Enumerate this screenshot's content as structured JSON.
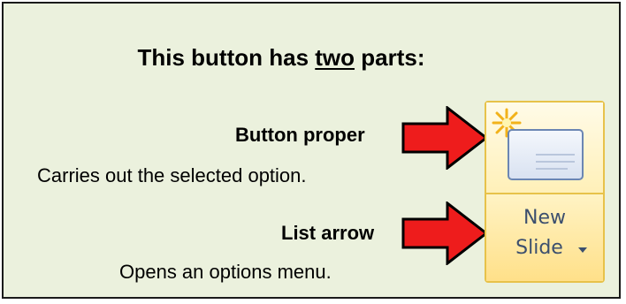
{
  "title": {
    "prefix": "This button has ",
    "emphasis": "two",
    "suffix": " parts:"
  },
  "button_proper": {
    "label": "Button proper",
    "description": "Carries out the selected option."
  },
  "list_arrow": {
    "label": "List arrow",
    "description": "Opens an options menu."
  },
  "new_slide_button": {
    "line1": "New",
    "line2": "Slide",
    "icon": "new-slide-icon",
    "dropdown_icon": "dropdown-arrow-icon"
  },
  "colors": {
    "panel_background": "#ebf1dd",
    "arrow_fill": "#ee1c1c",
    "button_border": "#e7c24a",
    "button_text": "#3c4f6e"
  }
}
